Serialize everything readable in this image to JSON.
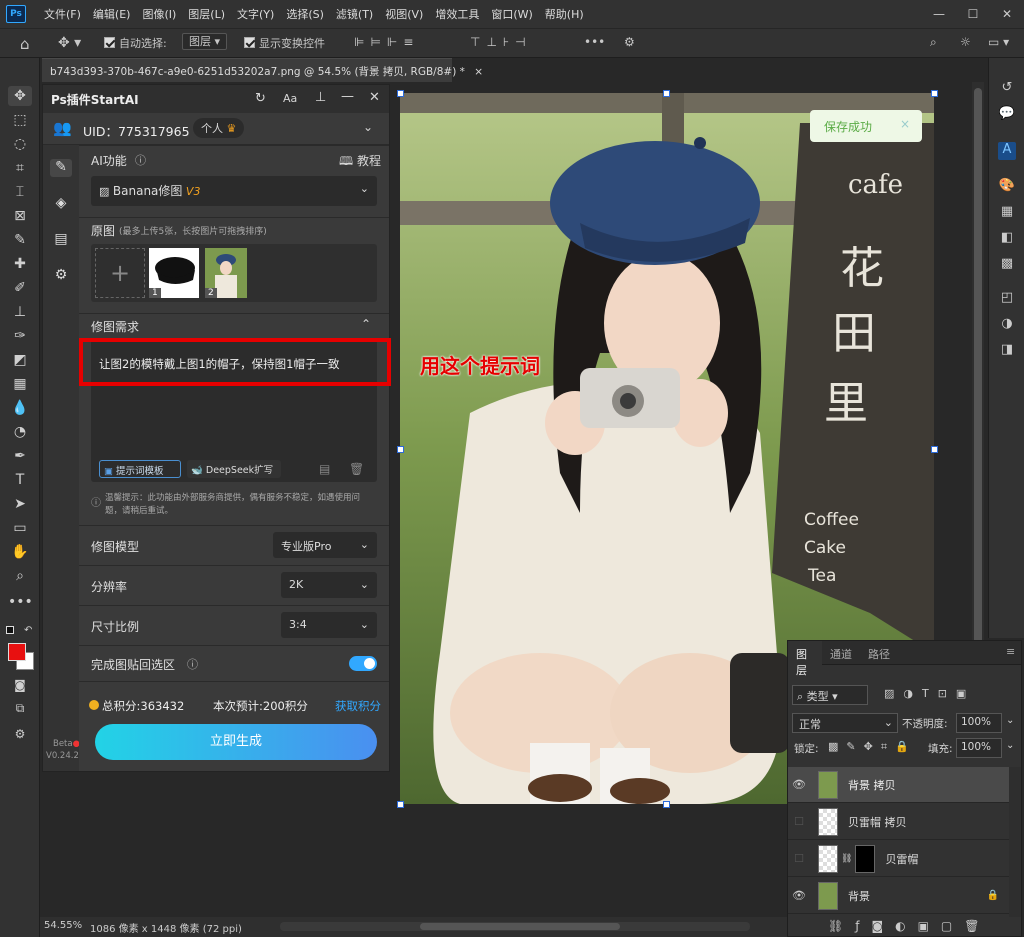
{
  "app": {
    "logo": "Ps",
    "menus": [
      "文件(F)",
      "编辑(E)",
      "图像(I)",
      "图层(L)",
      "文字(Y)",
      "选择(S)",
      "滤镜(T)",
      "视图(V)",
      "增效工具",
      "窗口(W)",
      "帮助(H)"
    ]
  },
  "options_bar": {
    "auto_select_label": "自动选择:",
    "auto_select_value": "图层",
    "show_transform_label": "显示变换控件",
    "more": "•••"
  },
  "document": {
    "tab_title": "b743d393-370b-467c-a9e0-6251d53202a7.png @ 54.5% (背景 拷贝, RGB/8#) *",
    "close": "×"
  },
  "plugin": {
    "title": "Ps插件StartAI",
    "uid_label": "UID：775317965",
    "plan": "个人",
    "ai_feature_label": "AI功能",
    "tutorial": "教程",
    "feature_select": "Banana修图",
    "feature_version": "V3",
    "original_label": "原图",
    "original_hint": "(最多上传5张，长按图片可拖拽排序)",
    "thumb1_index": "1",
    "thumb2_index": "2",
    "requirement_label": "修图需求",
    "prompt_text": "让图2的模特戴上图1的帽子，保持图1帽子一致",
    "prompt_template_btn": "提示词模板",
    "deepseek_btn": "DeepSeek扩写",
    "notice": "温馨提示：此功能由外部服务商提供，偶有服务不稳定，如遇使用问题，请稍后重试。",
    "model_label": "修图模型",
    "model_value": "专业版Pro",
    "resolution_label": "分辨率",
    "resolution_value": "2K",
    "ratio_label": "尺寸比例",
    "ratio_value": "3:4",
    "paste_back_label": "完成图贴回选区",
    "paste_back_on": true,
    "points": "总积分:363432",
    "estimate": "本次预计:200积分",
    "get_points": "获取积分",
    "generate_btn": "立即生成",
    "beta": "Beta",
    "version": "V0.24.2"
  },
  "annotation": {
    "text": "用这个提示词"
  },
  "photo_sign": {
    "cafe": "cafe",
    "hua": "花",
    "tian": "田",
    "li": "里",
    "coffee": "Coffee",
    "cake": "Cake",
    "tea": "Tea"
  },
  "toast": {
    "text": "保存成功",
    "close": "×"
  },
  "layers_panel": {
    "tabs": [
      "图层",
      "通道",
      "路径"
    ],
    "filter_label": "类型",
    "blend_mode": "正常",
    "opacity_label": "不透明度:",
    "opacity_value": "100%",
    "lock_label": "锁定:",
    "fill_label": "填充:",
    "fill_value": "100%",
    "layers": [
      {
        "name": "背景 拷贝",
        "visible": true,
        "selected": true
      },
      {
        "name": "贝雷帽 拷贝",
        "visible": false,
        "selected": false
      },
      {
        "name": "贝雷帽",
        "visible": false,
        "selected": false
      },
      {
        "name": "背景",
        "visible": true,
        "selected": false,
        "locked": true
      }
    ]
  },
  "status": {
    "zoom": "54.55%",
    "doc_size": "1086 像素 x 1448 像素 (72 ppi)"
  },
  "colors": {
    "foreground": "#e81010",
    "background": "#ffffff",
    "accent": "#31a8ff",
    "annotation_red": "#e60000"
  }
}
